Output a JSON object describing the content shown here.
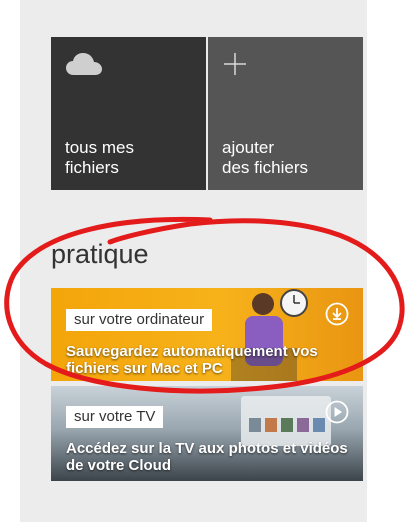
{
  "tiles": {
    "files": {
      "label_line1": "tous mes",
      "label_line2": "fichiers",
      "icon": "cloud-icon"
    },
    "add": {
      "label_line1": "ajouter",
      "label_line2": "des fichiers",
      "icon": "plus-icon"
    }
  },
  "section": {
    "title": "pratique"
  },
  "cards": {
    "computer": {
      "tag": "sur votre ordinateur",
      "description": "Sauvegardez automatiquement vos fichiers sur Mac et PC",
      "icon": "download-icon"
    },
    "tv": {
      "tag": "sur votre TV",
      "description": "Accédez sur la TV aux photos et vidéos de votre Cloud",
      "icon": "play-icon"
    }
  },
  "colors": {
    "tile_files": "#333333",
    "tile_add": "#555555",
    "panel_bg": "#ececec",
    "accent_orange": "#f7b21a",
    "annotation_red": "#e31b1b"
  }
}
